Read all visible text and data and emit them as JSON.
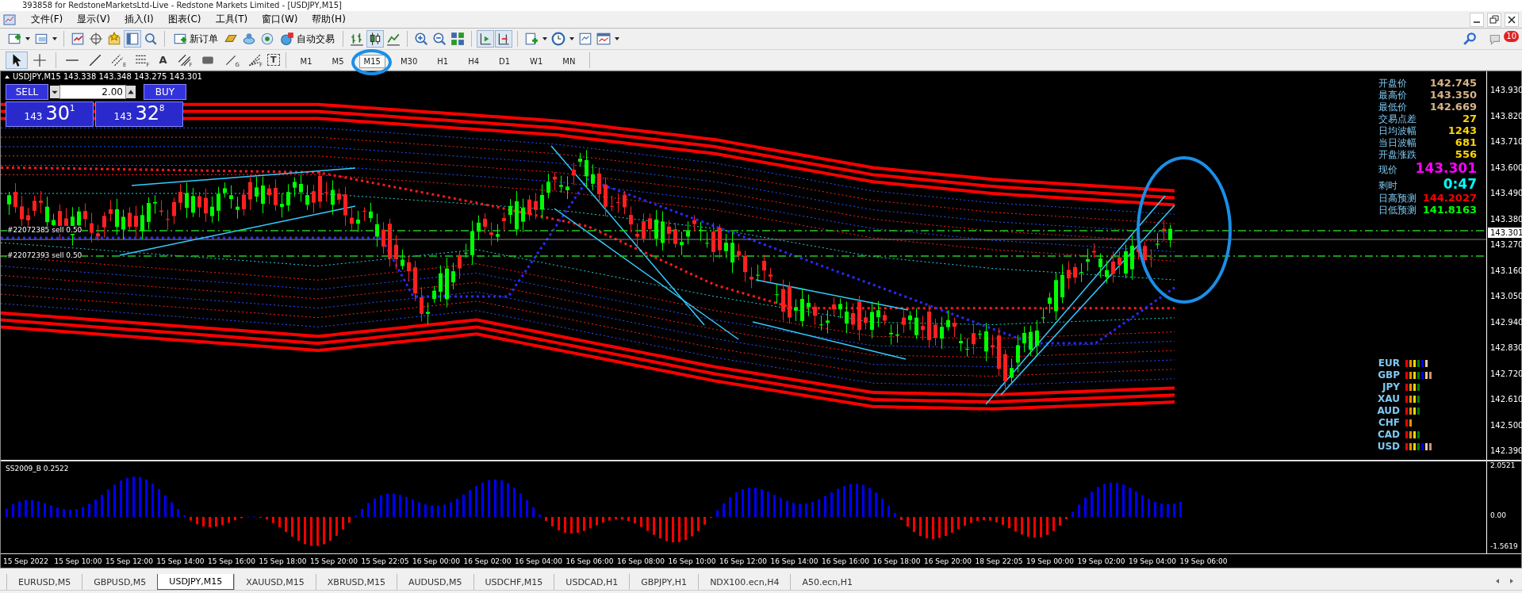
{
  "window": {
    "title": "393858 for RedstoneMarketsLtd-Live - Redstone Markets Limited - [USDJPY,M15]"
  },
  "menu": [
    "文件(F)",
    "显示(V)",
    "插入(I)",
    "图表(C)",
    "工具(T)",
    "窗口(W)",
    "帮助(H)"
  ],
  "toolbar": {
    "new_order": "新订单",
    "auto_trading": "自动交易",
    "notification_count": "10"
  },
  "drawing_tools": [
    {
      "kind": "cursor"
    },
    {
      "kind": "crosshair"
    },
    {
      "kind": "hline"
    },
    {
      "kind": "trendline"
    },
    {
      "kind": "channel",
      "sub": "E"
    },
    {
      "kind": "fibo",
      "sub": "F"
    },
    {
      "kind": "text",
      "label": "A"
    },
    {
      "kind": "parallel",
      "sub": "F"
    },
    {
      "kind": "rect"
    },
    {
      "kind": "arrow",
      "sub": "G"
    },
    {
      "kind": "fan",
      "sub": "F"
    },
    {
      "kind": "label",
      "label": "T"
    }
  ],
  "timeframes": [
    {
      "label": "M1",
      "selected": false
    },
    {
      "label": "M5",
      "selected": false
    },
    {
      "label": "M15",
      "selected": true
    },
    {
      "label": "M30",
      "selected": false
    },
    {
      "label": "H1",
      "selected": false
    },
    {
      "label": "H4",
      "selected": false
    },
    {
      "label": "D1",
      "selected": false
    },
    {
      "label": "W1",
      "selected": false
    },
    {
      "label": "MN",
      "selected": false
    }
  ],
  "chart": {
    "header": "USDJPY,M15  143.338 143.348 143.275 143.301",
    "trade_panel": {
      "sell": "SELL",
      "buy": "BUY",
      "lots": "2.00",
      "sell_price": {
        "big": "143",
        "main": "30",
        "small": "1"
      },
      "buy_price": {
        "big": "143",
        "main": "32",
        "small": "8"
      }
    },
    "order_lines": [
      "#22072385 sell 0.50",
      "#22072393 sell 0.50"
    ],
    "info": [
      {
        "label": "开盘价",
        "value": "142.745",
        "color": "#d8b48a",
        "kind": "normal"
      },
      {
        "label": "最高价",
        "value": "143.350",
        "color": "#d8b48a",
        "kind": "normal"
      },
      {
        "label": "最低价",
        "value": "142.669",
        "color": "#d8b48a",
        "kind": "normal"
      },
      {
        "label": "交易点差",
        "value": "27",
        "color": "#ffd700",
        "kind": "normal"
      },
      {
        "label": "日均波幅",
        "value": "1243",
        "color": "#ffd700",
        "kind": "normal"
      },
      {
        "label": "当日波幅",
        "value": "681",
        "color": "#ffd700",
        "kind": "normal"
      },
      {
        "label": "开盘涨跌",
        "value": "556",
        "color": "#ffd700",
        "kind": "normal"
      },
      {
        "label": "现价",
        "value": "143.301",
        "color": "#ff00ff",
        "kind": "big"
      },
      {
        "label": "剩时",
        "value": "0:47",
        "color": "#00ffff",
        "kind": "big"
      },
      {
        "label": "日高预测",
        "value": "144.2027",
        "color": "#ff0000",
        "kind": "normal"
      },
      {
        "label": "日低预测",
        "value": "141.8163",
        "color": "#00ff00",
        "kind": "normal"
      }
    ],
    "strength": [
      {
        "name": "EUR",
        "bars": [
          {
            "color": "#ff0000"
          },
          {
            "color": "#ff8c00"
          },
          {
            "color": "#ffd700"
          },
          {
            "color": "#008000"
          },
          {
            "color": "#0000ff"
          },
          {
            "color": "#ffc8a0"
          }
        ]
      },
      {
        "name": "GBP",
        "bars": [
          {
            "color": "#ff0000"
          },
          {
            "color": "#ff8c00"
          },
          {
            "color": "#ffd700"
          },
          {
            "color": "#008000"
          },
          {
            "color": "#0000ff"
          },
          {
            "color": "#ffc8a0"
          },
          {
            "color": "#d2906a"
          }
        ]
      },
      {
        "name": "JPY",
        "bars": [
          {
            "color": "#ff0000"
          },
          {
            "color": "#ff8c00"
          },
          {
            "color": "#ffd700"
          },
          {
            "color": "#008000"
          }
        ]
      },
      {
        "name": "XAU",
        "bars": [
          {
            "color": "#ff0000"
          },
          {
            "color": "#ff8c00"
          },
          {
            "color": "#ffd700"
          },
          {
            "color": "#008000"
          }
        ]
      },
      {
        "name": "AUD",
        "bars": [
          {
            "color": "#ff0000"
          },
          {
            "color": "#ff8c00"
          },
          {
            "color": "#ffd700"
          },
          {
            "color": "#008000"
          }
        ]
      },
      {
        "name": "CHF",
        "bars": [
          {
            "color": "#ff0000"
          },
          {
            "color": "#ff8c00"
          }
        ]
      },
      {
        "name": "CAD",
        "bars": [
          {
            "color": "#ff0000"
          },
          {
            "color": "#ff8c00"
          },
          {
            "color": "#ffd700"
          },
          {
            "color": "#008000"
          }
        ]
      },
      {
        "name": "USD",
        "bars": [
          {
            "color": "#ff0000"
          },
          {
            "color": "#ff8c00"
          },
          {
            "color": "#ffd700"
          },
          {
            "color": "#008000"
          },
          {
            "color": "#0000ff"
          },
          {
            "color": "#ffc8a0"
          },
          {
            "color": "#d2906a"
          }
        ]
      }
    ],
    "price_axis": [
      "143.930",
      "143.820",
      "143.710",
      "143.600",
      "143.490",
      "143.380",
      "143.270",
      "143.160",
      "143.050",
      "142.940",
      "142.830",
      "142.720",
      "142.610",
      "142.500",
      "142.390"
    ],
    "current_price": "143.301",
    "indicator": {
      "label": "SS2009_B 0.2522",
      "axis": [
        "2.0521",
        "0.00",
        "-1.5619"
      ]
    },
    "time_axis": [
      "15 Sep 2022",
      "15 Sep 10:00",
      "15 Sep 12:00",
      "15 Sep 14:00",
      "15 Sep 16:00",
      "15 Sep 18:00",
      "15 Sep 20:00",
      "15 Sep 22:05",
      "16 Sep 00:00",
      "16 Sep 02:00",
      "16 Sep 04:00",
      "16 Sep 06:00",
      "16 Sep 08:00",
      "16 Sep 10:00",
      "16 Sep 12:00",
      "16 Sep 14:00",
      "16 Sep 16:00",
      "16 Sep 18:00",
      "16 Sep 20:00",
      "18 Sep 22:05",
      "19 Sep 00:00",
      "19 Sep 02:00",
      "19 Sep 04:00",
      "19 Sep 06:00"
    ]
  },
  "tabs": [
    {
      "label": "EURUSD,M5",
      "selected": false
    },
    {
      "label": "GBPUSD,M5",
      "selected": false
    },
    {
      "label": "USDJPY,M15",
      "selected": true
    },
    {
      "label": "XAUUSD,M15",
      "selected": false
    },
    {
      "label": "XBRUSD,M15",
      "selected": false
    },
    {
      "label": "AUDUSD,M5",
      "selected": false
    },
    {
      "label": "USDCHF,M15",
      "selected": false
    },
    {
      "label": "USDCAD,H1",
      "selected": false
    },
    {
      "label": "GBPJPY,H1",
      "selected": false
    },
    {
      "label": "NDX100.ecn,H4",
      "selected": false
    },
    {
      "label": "A50.ecn,H1",
      "selected": false
    }
  ]
}
